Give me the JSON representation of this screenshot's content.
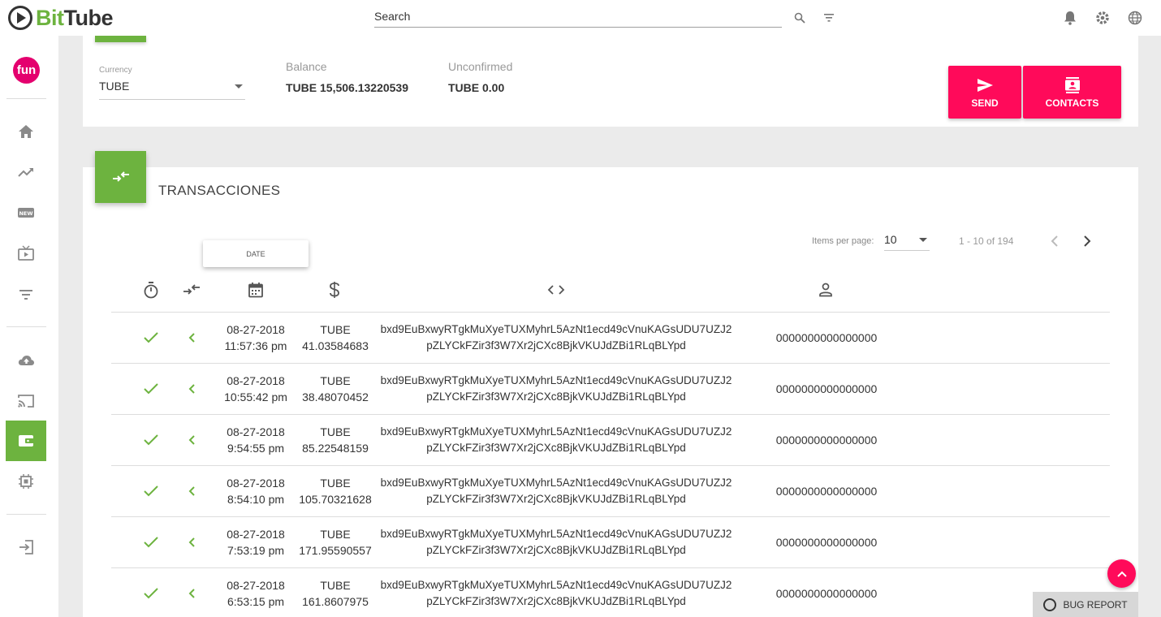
{
  "brand": {
    "bit": "Bit",
    "tube": "Tube"
  },
  "search": {
    "placeholder": "Search"
  },
  "sidebar": {
    "avatar_text": "fun",
    "items": [
      "home-icon",
      "trending-icon",
      "new-icon",
      "tv-icon",
      "filter-icon",
      "upload-icon",
      "cast-icon",
      "wallet-icon",
      "chip-icon",
      "logout-icon"
    ],
    "active_index": 7
  },
  "wallet": {
    "currency_label": "Currency",
    "currency_value": "TUBE",
    "balance_label": "Balance",
    "balance_value": "TUBE 15,506.13220539",
    "unconfirmed_label": "Unconfirmed",
    "unconfirmed_value": "TUBE 0.00",
    "send_label": "SEND",
    "contacts_label": "CONTACTS"
  },
  "transactions": {
    "title": "TRANSACCIONES",
    "items_per_page_label": "Items per page:",
    "items_per_page": "10",
    "range": "1 - 10 of 194",
    "tooltip": "DATE",
    "rows": [
      {
        "date": "08-27-2018",
        "time": "11:57:36 pm",
        "currency": "TUBE",
        "amount": "41.03584683",
        "hash1": "bxd9EuBxwyRTgkMuXyeTUXMyhrL5AzNt1ecd49cVnuKAGsUDU7UZJ2",
        "hash2": "pZLYCkFZir3f3W7Xr2jCXc8BjkVKUJdZBi1RLqBLYpd",
        "payment_id": "0000000000000000"
      },
      {
        "date": "08-27-2018",
        "time": "10:55:42 pm",
        "currency": "TUBE",
        "amount": "38.48070452",
        "hash1": "bxd9EuBxwyRTgkMuXyeTUXMyhrL5AzNt1ecd49cVnuKAGsUDU7UZJ2",
        "hash2": "pZLYCkFZir3f3W7Xr2jCXc8BjkVKUJdZBi1RLqBLYpd",
        "payment_id": "0000000000000000"
      },
      {
        "date": "08-27-2018",
        "time": "9:54:55 pm",
        "currency": "TUBE",
        "amount": "85.22548159",
        "hash1": "bxd9EuBxwyRTgkMuXyeTUXMyhrL5AzNt1ecd49cVnuKAGsUDU7UZJ2",
        "hash2": "pZLYCkFZir3f3W7Xr2jCXc8BjkVKUJdZBi1RLqBLYpd",
        "payment_id": "0000000000000000"
      },
      {
        "date": "08-27-2018",
        "time": "8:54:10 pm",
        "currency": "TUBE",
        "amount": "105.70321628",
        "hash1": "bxd9EuBxwyRTgkMuXyeTUXMyhrL5AzNt1ecd49cVnuKAGsUDU7UZJ2",
        "hash2": "pZLYCkFZir3f3W7Xr2jCXc8BjkVKUJdZBi1RLqBLYpd",
        "payment_id": "0000000000000000"
      },
      {
        "date": "08-27-2018",
        "time": "7:53:19 pm",
        "currency": "TUBE",
        "amount": "171.95590557",
        "hash1": "bxd9EuBxwyRTgkMuXyeTUXMyhrL5AzNt1ecd49cVnuKAGsUDU7UZJ2",
        "hash2": "pZLYCkFZir3f3W7Xr2jCXc8BjkVKUJdZBi1RLqBLYpd",
        "payment_id": "0000000000000000"
      },
      {
        "date": "08-27-2018",
        "time": "6:53:15 pm",
        "currency": "TUBE",
        "amount": "161.8607975",
        "hash1": "bxd9EuBxwyRTgkMuXyeTUXMyhrL5AzNt1ecd49cVnuKAGsUDU7UZJ2",
        "hash2": "pZLYCkFZir3f3W7Xr2jCXc8BjkVKUJdZBi1RLqBLYpd",
        "payment_id": "0000000000000000"
      }
    ]
  },
  "bug_report_label": "BUG REPORT",
  "colors": {
    "accent_green": "#6db33f",
    "accent_pink": "#ff0a5a"
  }
}
